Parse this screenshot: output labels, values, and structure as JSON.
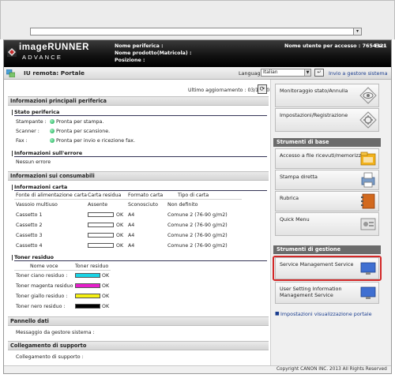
{
  "header": {
    "logo_line1": "imageRUNNER",
    "logo_line2": "ADVANCE",
    "device_name_label": "Nome periferica :",
    "product_label": "Nome prodotto(Matricola) :",
    "position_label": "Posizione :",
    "user_label": "Nome utente per accesso : 7654321",
    "logout": "Esci"
  },
  "titlebar": {
    "title": "IU remota: Portale",
    "language_label": "Language:",
    "language_value": "Italian",
    "to_manager": "Invio a gestore sistema"
  },
  "last_update": "Ultimo aggiornamento : 03/10 2014 9:19:43",
  "main_info": {
    "title": "Informazioni principali periferica",
    "status_title": "Stato periferica",
    "status_rows": [
      {
        "label": "Stampante :",
        "value": "Pronta per stampa."
      },
      {
        "label": "Scanner :",
        "value": "Pronta per scansione."
      },
      {
        "label": "Fax :",
        "value": "Pronta per invio e ricezione fax."
      }
    ],
    "error_title": "Informazioni sull'errore",
    "error_value": "Nessun errore"
  },
  "consumables": {
    "title": "Informazioni sui consumabili",
    "paper_title": "Informazioni carta",
    "paper_headers": [
      "Fonte di alimentazione carta",
      "Carta residua",
      "Formato carta",
      "Tipo di carta"
    ],
    "paper_rows": [
      {
        "source": "Vassoio multiuso",
        "remaining": "Assente",
        "size": "Sconosciuto",
        "type": "Non definito",
        "bar": false
      },
      {
        "source": "Cassetto 1",
        "remaining": "OK",
        "size": "A4",
        "type": "Comune 2 (76-90 g/m2)",
        "bar": true
      },
      {
        "source": "Cassetto 2",
        "remaining": "OK",
        "size": "A4",
        "type": "Comune 2 (76-90 g/m2)",
        "bar": true
      },
      {
        "source": "Cassetto 3",
        "remaining": "OK",
        "size": "A4",
        "type": "Comune 2 (76-90 g/m2)",
        "bar": true
      },
      {
        "source": "Cassetto 4",
        "remaining": "OK",
        "size": "A4",
        "type": "Comune 2 (76-90 g/m2)",
        "bar": true
      }
    ],
    "toner_title": "Toner residuo",
    "toner_headers": [
      "Nome voce",
      "Toner residuo"
    ],
    "toner_rows": [
      {
        "name": "Toner ciano residuo :",
        "value": "OK",
        "color": "#19d4e6"
      },
      {
        "name": "Toner magenta residuo :",
        "value": "OK",
        "color": "#e61ecb"
      },
      {
        "name": "Toner giallo residuo :",
        "value": "OK",
        "color": "#f4ef12"
      },
      {
        "name": "Toner nero residuo :",
        "value": "OK",
        "color": "#000000"
      }
    ]
  },
  "message_board": {
    "title": "Pannello dati",
    "text": "Messaggio da gestore sistema :"
  },
  "support_link": {
    "title": "Collegamento di supporto",
    "text": "Collegamento di supporto :"
  },
  "right_panel": {
    "btn_monitor": "Monitoraggio stato/Annulla",
    "btn_settings": "Impostazioni/Registrazione",
    "basic_tools_title": "Strumenti di base",
    "btn_access_files": "Accesso a file ricevuti/memorizzati",
    "btn_direct_print": "Stampa diretta",
    "btn_address_book": "Rubrica",
    "btn_quick_menu": "Quick Menu",
    "mgmt_tools_title": "Strumenti di gestione",
    "btn_service_mgmt": "Service Management Service",
    "btn_user_setting": "User Setting Information Management Service",
    "portal_display_link": "Impostazioni visualizzazione portale"
  },
  "footer": {
    "copyright": "Copyright CANON INC. 2013 All Rights Reserved"
  },
  "colors": {
    "status_green": "#11a84f",
    "highlight_red": "#d32727",
    "link_blue": "#1a3d8f"
  }
}
